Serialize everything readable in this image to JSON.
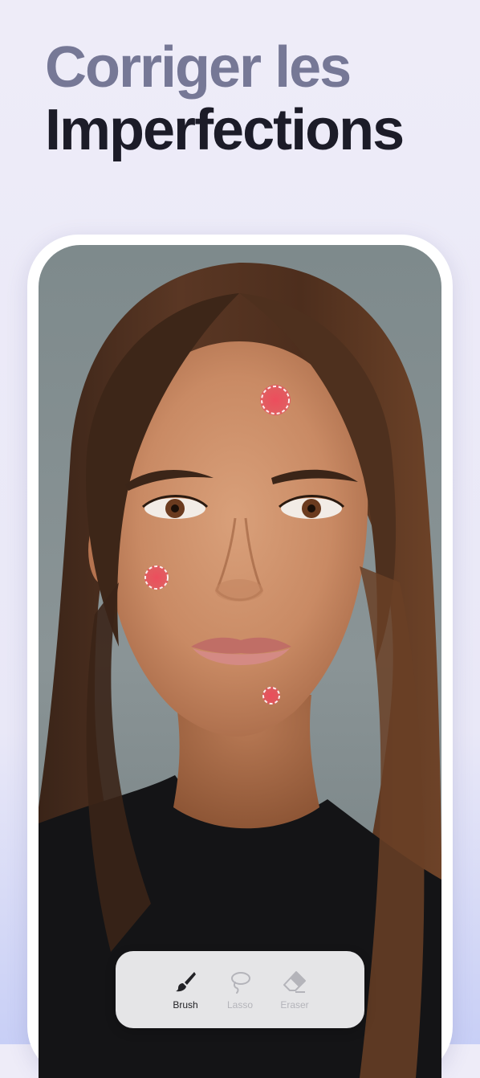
{
  "headline": {
    "line1": "Corriger les",
    "line2": "Imperfections"
  },
  "editor": {
    "blemish_markers": 3
  },
  "toolbar": {
    "selected": "Brush",
    "tools": [
      {
        "label": "Brush",
        "icon": "brush-icon",
        "active": true
      },
      {
        "label": "Lasso",
        "icon": "lasso-icon",
        "active": false
      },
      {
        "label": "Eraser",
        "icon": "eraser-icon",
        "active": false
      }
    ]
  },
  "colors": {
    "headline_light": "#767896",
    "headline_dark": "#1c1c28",
    "marker": "#e8505f",
    "active_tool": "#222226",
    "inactive_tool": "#b4b4ba"
  }
}
